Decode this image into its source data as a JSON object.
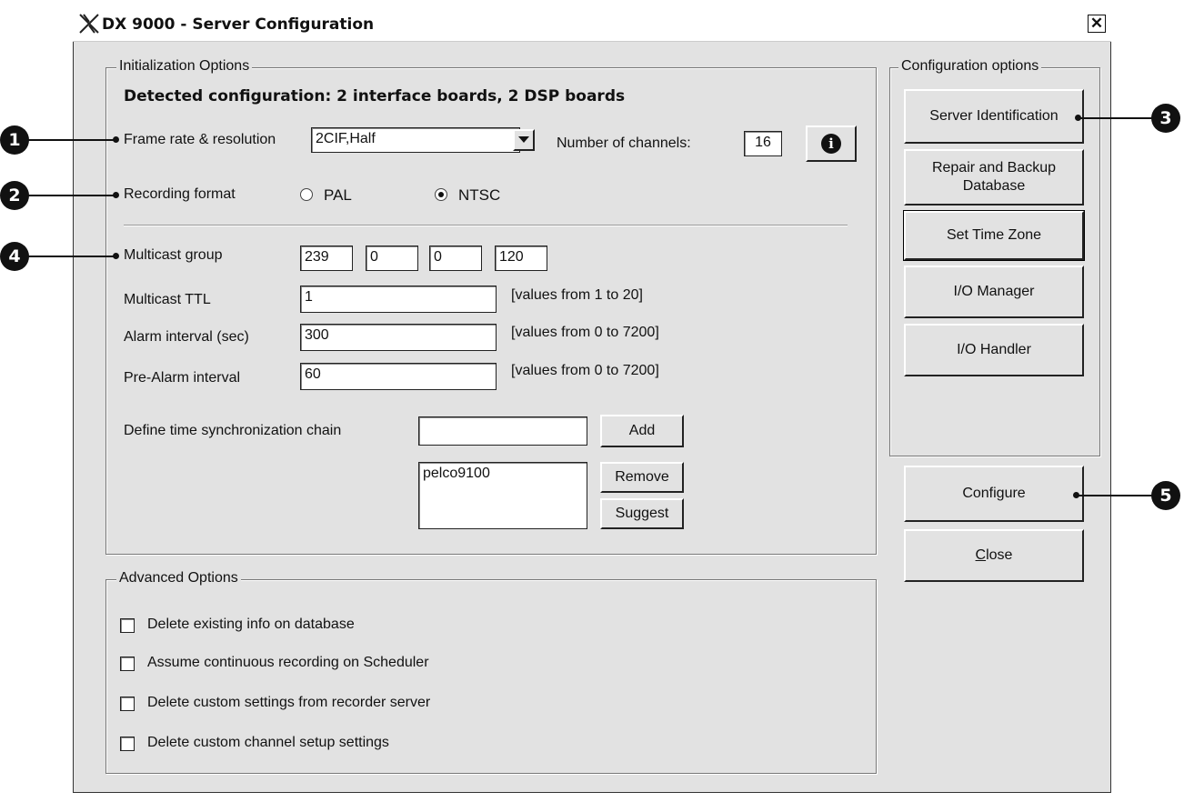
{
  "window": {
    "title": "DX 9000 - Server Configuration",
    "close_glyph": "✕"
  },
  "init": {
    "legend": "Initialization Options",
    "detected": "Detected configuration: 2 interface boards, 2 DSP boards",
    "frame_label": "Frame rate & resolution",
    "frame_value": "2CIF,Half",
    "channels_label": "Number of channels:",
    "channels_value": "16",
    "info_glyph": "i",
    "recording_label": "Recording format",
    "pal_label": "PAL",
    "ntsc_label": "NTSC",
    "recording_selected": "NTSC",
    "multicast_label": "Multicast group",
    "multicast": [
      "239",
      "0",
      "0",
      "120"
    ],
    "ttl_label": "Multicast TTL",
    "ttl_value": "1",
    "ttl_hint": "[values from 1 to 20]",
    "alarm_label": "Alarm interval (sec)",
    "alarm_value": "300",
    "alarm_hint": "[values from 0 to 7200]",
    "prealarm_label": "Pre-Alarm interval",
    "prealarm_value": "60",
    "prealarm_hint": "[values from 0 to 7200]",
    "sync_label": "Define time synchronization chain",
    "sync_input": "",
    "add": "Add",
    "sync_list": [
      "pelco9100"
    ],
    "remove": "Remove",
    "suggest": "Suggest"
  },
  "advanced": {
    "legend": "Advanced Options",
    "options": [
      {
        "label": "Delete existing info on database",
        "checked": false
      },
      {
        "label": "Assume continuous recording on Scheduler",
        "checked": false
      },
      {
        "label": "Delete custom settings from recorder server",
        "checked": false
      },
      {
        "label": "Delete custom channel setup settings",
        "checked": false
      }
    ]
  },
  "config": {
    "legend": "Configuration options",
    "buttons": [
      "Server Identification",
      "Repair and Backup Database",
      "Set Time Zone",
      "I/O Manager",
      "I/O Handler"
    ]
  },
  "actions": {
    "configure": "Configure",
    "close_mnemonic": "C",
    "close_rest": "lose"
  },
  "callouts": [
    "1",
    "2",
    "3",
    "4",
    "5"
  ]
}
